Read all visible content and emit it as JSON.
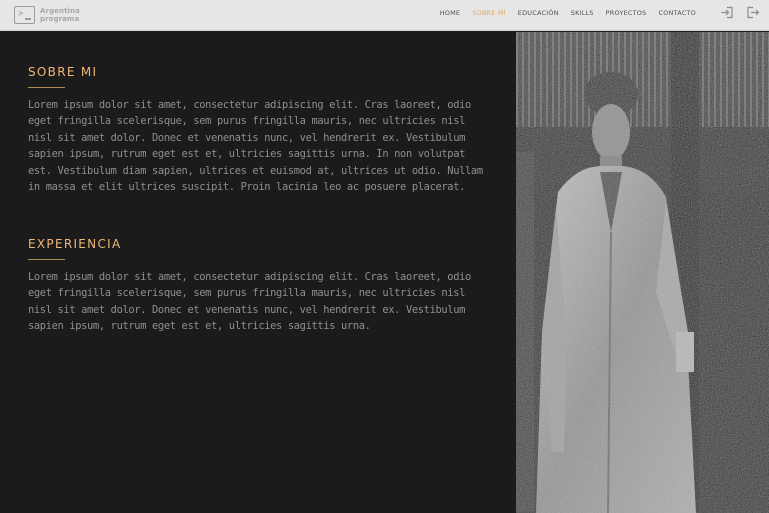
{
  "header": {
    "logo": {
      "line1": "Argentina",
      "line2": "programa"
    },
    "nav": [
      {
        "label": "HOME",
        "active": false
      },
      {
        "label": "SOBRE MÍ",
        "active": true
      },
      {
        "label": "EDUCACIÓN",
        "active": false
      },
      {
        "label": "SKILLS",
        "active": false
      },
      {
        "label": "PROYECTOS",
        "active": false
      },
      {
        "label": "CONTACTO",
        "active": false
      }
    ],
    "icons": [
      "login-icon",
      "logout-icon"
    ]
  },
  "about": {
    "title": "SOBRE MI",
    "text": "Lorem ipsum dolor sit amet, consectetur adipiscing elit. Cras laoreet, odio eget fringilla scelerisque, sem purus fringilla mauris, nec ultricies nisl nisl sit amet dolor. Donec et venenatis nunc, vel hendrerit ex. Vestibulum sapien ipsum, rutrum eget est et, ultricies sagittis urna. In non volutpat est. Vestibulum diam sapien, ultrices et euismod at, ultrices ut odio. Nullam in massa et elit ultrices suscipit. Proin lacinia leo ac posuere placerat."
  },
  "experience": {
    "title": "EXPERIENCIA",
    "text": "Lorem ipsum dolor sit amet, consectetur adipiscing elit. Cras laoreet, odio eget fringilla scelerisque, sem purus fringilla mauris, nec ultricies nisl nisl sit amet dolor. Donec et venenatis nunc, vel hendrerit ex. Vestibulum sapien ipsum, rutrum eget est et, ultricies sagittis urna."
  },
  "colors": {
    "accent": "#f0b778",
    "topbar": "#e6e6e6",
    "background": "#1b1b1b",
    "body_text": "#8f8f8f"
  }
}
